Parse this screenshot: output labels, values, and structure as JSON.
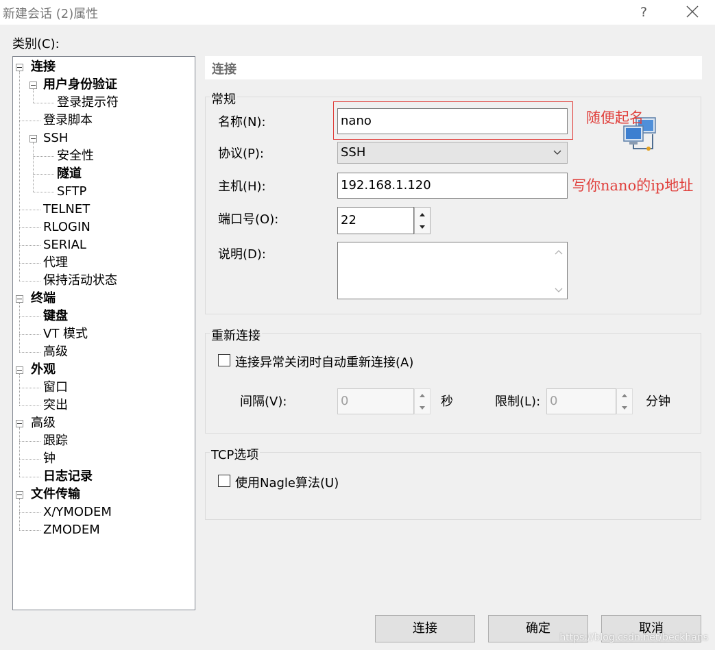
{
  "window": {
    "title": "新建会话 (2)属性",
    "help_glyph": "?"
  },
  "category_label": "类别(C):",
  "tree": [
    {
      "label": "连接",
      "bold": true,
      "level": 0,
      "expander": true
    },
    {
      "label": "用户身份验证",
      "bold": true,
      "level": 1,
      "expander": true
    },
    {
      "label": "登录提示符",
      "bold": false,
      "level": 2
    },
    {
      "label": "登录脚本",
      "bold": false,
      "level": 1
    },
    {
      "label": "SSH",
      "bold": false,
      "level": 1,
      "expander": true
    },
    {
      "label": "安全性",
      "bold": false,
      "level": 2
    },
    {
      "label": "隧道",
      "bold": true,
      "level": 2
    },
    {
      "label": "SFTP",
      "bold": false,
      "level": 2
    },
    {
      "label": "TELNET",
      "bold": false,
      "level": 1
    },
    {
      "label": "RLOGIN",
      "bold": false,
      "level": 1
    },
    {
      "label": "SERIAL",
      "bold": false,
      "level": 1
    },
    {
      "label": "代理",
      "bold": false,
      "level": 1
    },
    {
      "label": "保持活动状态",
      "bold": false,
      "level": 1
    },
    {
      "label": "终端",
      "bold": true,
      "level": 0,
      "expander": true
    },
    {
      "label": "键盘",
      "bold": true,
      "level": 1
    },
    {
      "label": "VT 模式",
      "bold": false,
      "level": 1
    },
    {
      "label": "高级",
      "bold": false,
      "level": 1
    },
    {
      "label": "外观",
      "bold": true,
      "level": 0,
      "expander": true
    },
    {
      "label": "窗口",
      "bold": false,
      "level": 1
    },
    {
      "label": "突出",
      "bold": false,
      "level": 1
    },
    {
      "label": "高级",
      "bold": false,
      "level": 0,
      "expander": true
    },
    {
      "label": "跟踪",
      "bold": false,
      "level": 1
    },
    {
      "label": "钟",
      "bold": false,
      "level": 1
    },
    {
      "label": "日志记录",
      "bold": true,
      "level": 1
    },
    {
      "label": "文件传输",
      "bold": true,
      "level": 0,
      "expander": true
    },
    {
      "label": "X/YMODEM",
      "bold": false,
      "level": 1
    },
    {
      "label": "ZMODEM",
      "bold": false,
      "level": 1
    }
  ],
  "section_title": "连接",
  "general": {
    "legend": "常规",
    "name_label": "名称(N):",
    "name_value": "nano",
    "protocol_label": "协议(P):",
    "protocol_value": "SSH",
    "host_label": "主机(H):",
    "host_value": "192.168.1.120",
    "port_label": "端口号(O):",
    "port_value": "22",
    "desc_label": "说明(D):",
    "desc_value": ""
  },
  "reconnect": {
    "legend": "重新连接",
    "checkbox_label": "连接异常关闭时自动重新连接(A)",
    "interval_label": "间隔(V):",
    "interval_value": "0",
    "interval_unit": "秒",
    "limit_label": "限制(L):",
    "limit_value": "0",
    "limit_unit": "分钟"
  },
  "tcp": {
    "legend": "TCP选项",
    "nagle_label": "使用Nagle算法(U)"
  },
  "buttons": {
    "connect": "连接",
    "ok": "确定",
    "cancel": "取消"
  },
  "annotations": {
    "name_hint": "随便起名",
    "host_hint": "写你nano的ip地址"
  },
  "watermark": "https://blog.csdn.net/beckhans"
}
